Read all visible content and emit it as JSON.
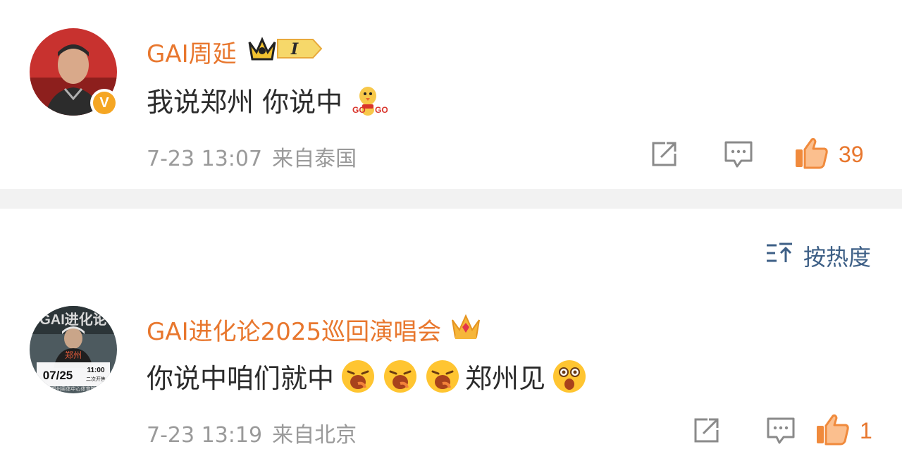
{
  "sort": {
    "label": "按热度",
    "icon": "sort-icon"
  },
  "posts": [
    {
      "username": "GAI周延",
      "badge_icon": "crown-level-badge",
      "badge_level": "I",
      "verified_mark": "V",
      "content": "我说郑州 你说中",
      "emojis": [
        "go-go-chick-emoji"
      ],
      "time": "7-23 13:07",
      "location": "来自泰国",
      "like_count": "39",
      "accent_color": "#e8772e"
    },
    {
      "username": "GAI进化论2025巡回演唱会",
      "badge_icon": "crown-icon",
      "content_part1": "你说中咱们就中",
      "content_part2": "郑州见",
      "emojis": [
        "laughing-emoji",
        "laughing-emoji",
        "laughing-emoji",
        "excited-emoji"
      ],
      "avatar_text": {
        "title": "GAI进化论",
        "city": "郑州",
        "date": "07/25",
        "time": "11:00",
        "sale": "二次开售",
        "venue": "郑州奥体中心体育馆"
      },
      "time": "7-23 13:19",
      "location": "来自北京",
      "like_count": "1"
    }
  ]
}
